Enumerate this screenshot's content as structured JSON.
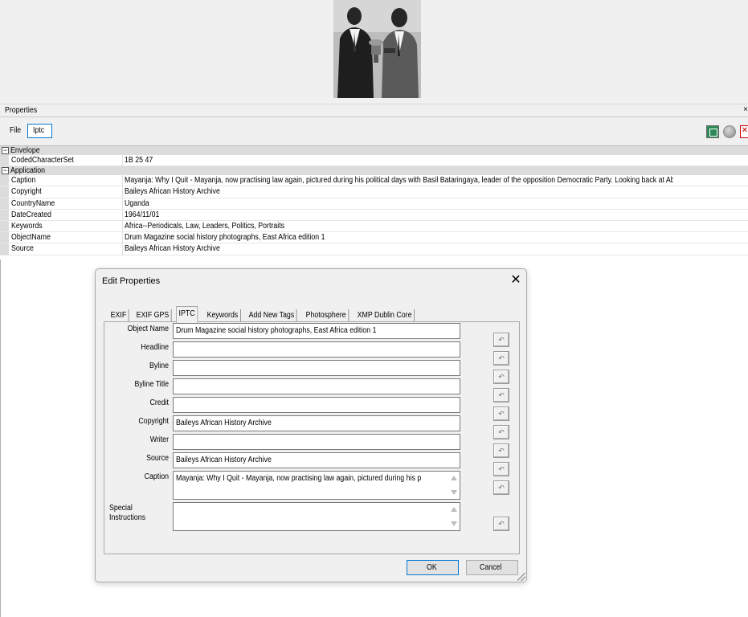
{
  "properties_panel": {
    "title": "Properties",
    "close_glyph": "×",
    "toolbar": {
      "file_label": "File",
      "iptc_label": "Iptc"
    },
    "toolbar_icons": [
      "grid-view-icon",
      "globe-icon",
      "clear-icon"
    ],
    "grid": {
      "envelope": {
        "label": "Envelope",
        "expand_glyph": "−",
        "rows": [
          {
            "name": "CodedCharacterSet",
            "value": "1B 25 47"
          }
        ]
      },
      "application": {
        "label": "Application",
        "expand_glyph": "−",
        "rows": [
          {
            "name": "Caption",
            "value": "Mayanja: Why I Quit - Mayanja, now practising law again, pictured during his political days with Basil Bataringaya, leader of the opposition Democratic Party. Looking back at Abu Mayanj..."
          },
          {
            "name": "Copyright",
            "value": "Baileys African History Archive"
          },
          {
            "name": "CountryName",
            "value": "Uganda"
          },
          {
            "name": "DateCreated",
            "value": "1964/11/01"
          },
          {
            "name": "Keywords",
            "value": "Africa--Periodicals, Law, Leaders, Politics, Portraits"
          },
          {
            "name": "ObjectName",
            "value": "Drum Magazine social history photographs, East Africa edition 1"
          },
          {
            "name": "Source",
            "value": "Baileys African History Archive"
          }
        ]
      }
    }
  },
  "dialog": {
    "title": "Edit Properties",
    "close_glyph": "✕",
    "tabs": [
      "EXIF",
      "EXIF GPS",
      "IPTC",
      "Keywords",
      "Add New Tags",
      "Photosphere",
      "XMP Dublin Core"
    ],
    "active_tab": "IPTC",
    "fields": {
      "object_name": {
        "label": "Object Name",
        "value": "Drum Magazine social history photographs, East Africa edition 1"
      },
      "headline": {
        "label": "Headline",
        "value": ""
      },
      "byline": {
        "label": "Byline",
        "value": ""
      },
      "byline_title": {
        "label": "Byline Title",
        "value": ""
      },
      "credit": {
        "label": "Credit",
        "value": ""
      },
      "copyright": {
        "label": "Copyright",
        "value": "Baileys African History Archive"
      },
      "writer": {
        "label": "Writer",
        "value": ""
      },
      "source": {
        "label": "Source",
        "value": "Baileys African History Archive"
      },
      "caption": {
        "label": "Caption",
        "value": "Mayanja: Why I Quit - Mayanja, now practising law again, pictured during his p"
      },
      "special_instructions": {
        "label_line1": "Special",
        "label_line2": "Instructions",
        "value": ""
      }
    },
    "reset_glyph": "↶",
    "ok_label": "OK",
    "cancel_label": "Cancel"
  }
}
